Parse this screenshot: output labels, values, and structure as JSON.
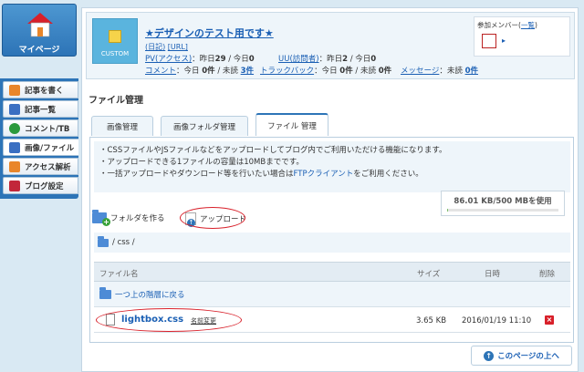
{
  "sidebar": {
    "mypage_label": "マイページ",
    "items": [
      {
        "label": "記事を書く",
        "icon": "pencil-icon",
        "color": "#e9862a"
      },
      {
        "label": "記事一覧",
        "icon": "list-icon",
        "color": "#3a6fc2"
      },
      {
        "label": "コメント/TB",
        "icon": "comment-icon",
        "color": "#2b9a3c"
      },
      {
        "label": "画像/ファイル",
        "icon": "image-icon",
        "color": "#3a6fc2"
      },
      {
        "label": "アクセス解析",
        "icon": "chart-icon",
        "color": "#e9862a"
      },
      {
        "label": "ブログ設定",
        "icon": "wrench-icon",
        "color": "#c2273a"
      }
    ]
  },
  "blog": {
    "logo_text": "CUSTOM",
    "title": "★デザインのテスト用です★",
    "links": [
      "(日記)",
      "[URL]"
    ],
    "pv_label": "PV(アクセス)",
    "pv_text": "：昨日",
    "pv_yesterday": "29",
    "pv_today_text": "/ 今日",
    "pv_today": "0",
    "uu_label": "UU(訪問者)",
    "uu_text": "：昨日",
    "uu_yesterday": "2",
    "uu_today_text": "/ 今日",
    "uu_today": "0",
    "comment_label": "コメント",
    "comment_text": "：今日",
    "comment_today": "0件",
    "comment_unread_text": "/ 未読",
    "comment_unread": "3件",
    "trackback_label": "トラックバック",
    "trackback_text": "：今日",
    "trackback_today": "0件",
    "trackback_unread_text": "/ 未読",
    "trackback_unread": "0件",
    "message_label": "メッセージ",
    "message_text": "：未読",
    "message_unread": "0件",
    "members_title": "参加メンバー",
    "members_link": "一覧"
  },
  "section_title": "ファイル管理",
  "tabs": [
    "画像管理",
    "画像フォルダ管理",
    "ファイル 管理"
  ],
  "info": {
    "line1": "・CSSファイルやJSファイルなどをアップロードしてブログ内でご利用いただける機能になります。",
    "line2": "・アップロードできる1ファイルの容量は10MBまでです。",
    "line3_pre": "・一括アップロードやダウンロード等を行いたい場合は",
    "line3_link": "FTPクライアント",
    "line3_post": "をご利用ください。"
  },
  "usage": {
    "text": "86.01 KB/500 MBを使用",
    "fraction": 0.0002
  },
  "actions": {
    "make_folder": "フォルダを作る",
    "upload": "アップロード"
  },
  "path": "/ css /",
  "table": {
    "headers": [
      "ファイル名",
      "サイズ",
      "日時",
      "削除"
    ],
    "up_row": "一つ上の階層に戻る",
    "files": [
      {
        "name": "lightbox.css",
        "rename": "名前変更",
        "size": "3.65 KB",
        "date": "2016/01/19 11:10"
      }
    ]
  },
  "page_top": "このページの上へ",
  "colors": {
    "accent": "#2d74b7",
    "link": "#1a5fb4",
    "annotation": "#d8202a"
  }
}
